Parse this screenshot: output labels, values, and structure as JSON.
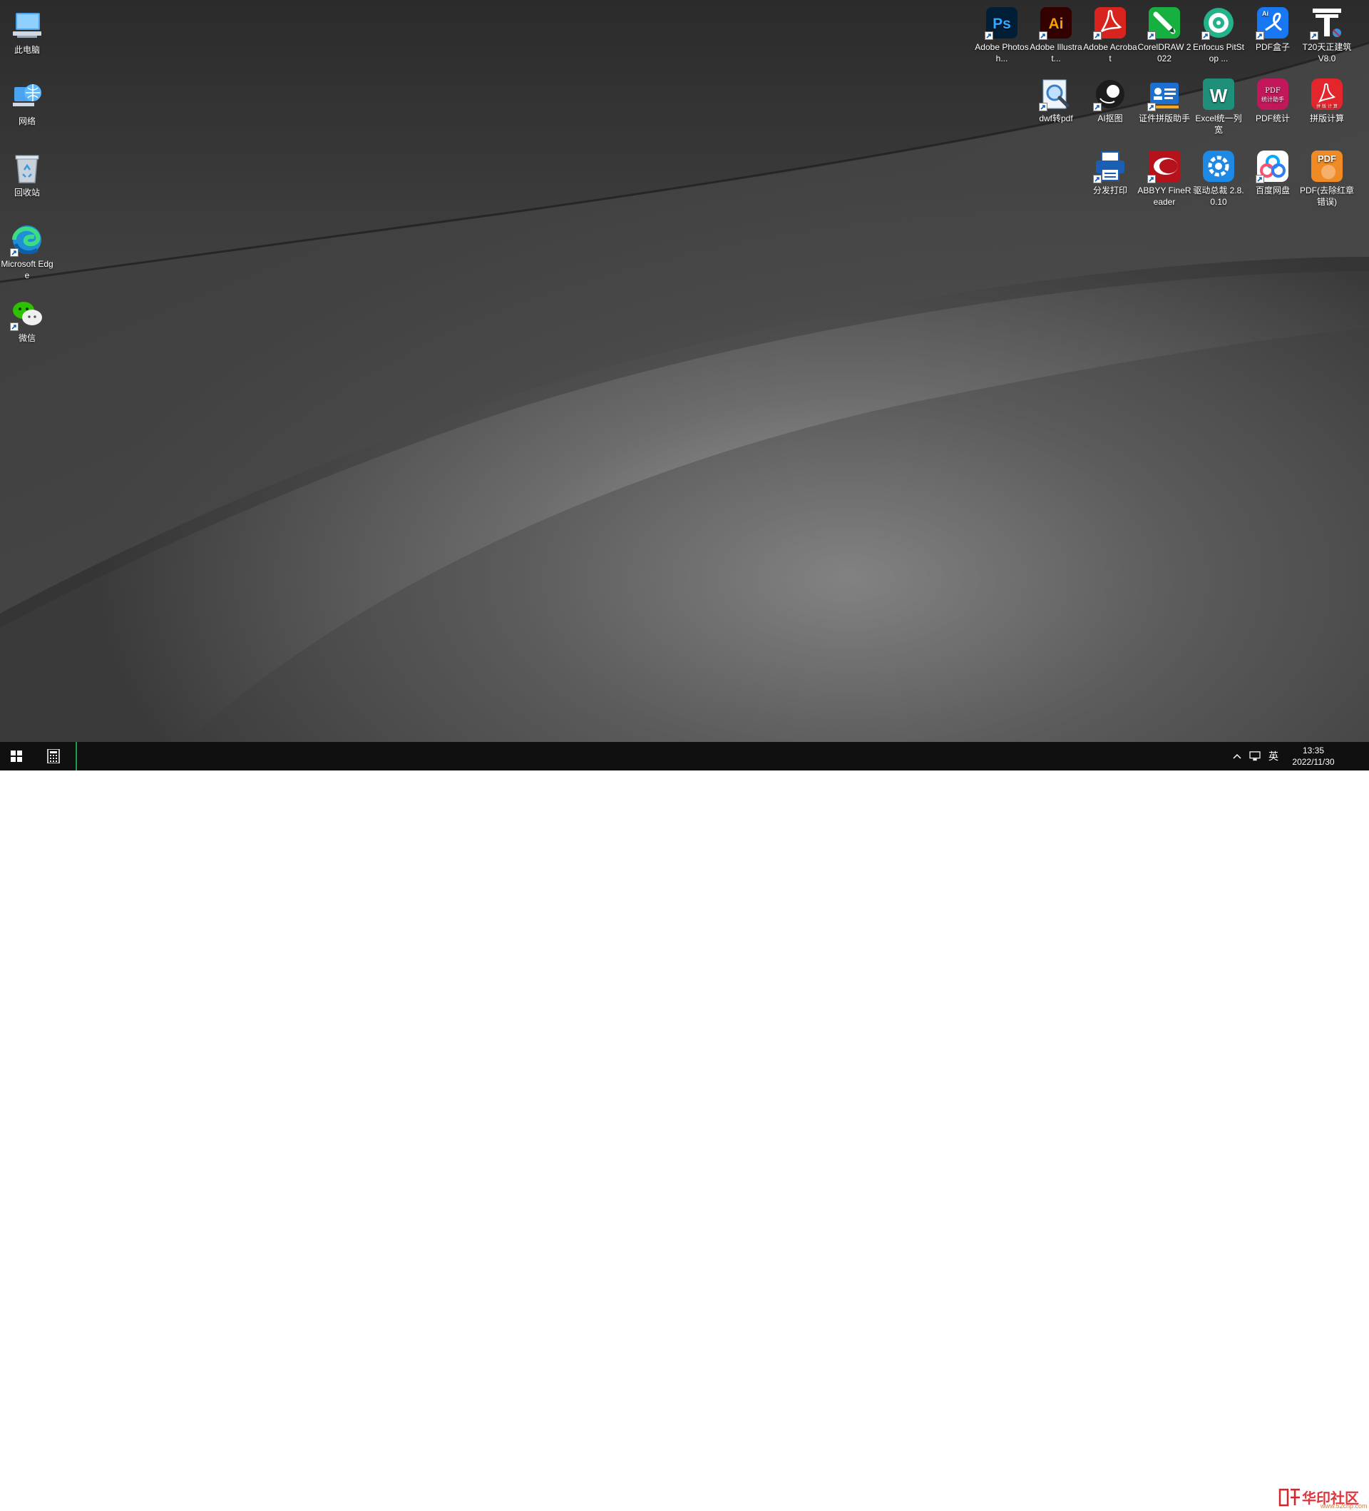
{
  "desktop": {
    "left_icons": [
      {
        "label": "此电脑",
        "icon": "computer-icon"
      },
      {
        "label": "网络",
        "icon": "network-icon"
      },
      {
        "label": "回收站",
        "icon": "recycle-bin-icon"
      },
      {
        "label": "Microsoft Edge",
        "icon": "edge-icon"
      },
      {
        "label": "微信",
        "icon": "wechat-icon"
      }
    ],
    "right_icons_row1": [
      {
        "label": "Adobe Photosh...",
        "icon": "photoshop-icon",
        "glyph": "Ps"
      },
      {
        "label": "Adobe Illustrat...",
        "icon": "illustrator-icon",
        "glyph": "Ai"
      },
      {
        "label": "Adobe Acrobat",
        "icon": "acrobat-icon"
      },
      {
        "label": "CorelDRAW 2022",
        "icon": "coreldraw-icon"
      },
      {
        "label": "Enfocus PitStop ...",
        "icon": "pitstop-icon"
      },
      {
        "label": "PDF盒子",
        "icon": "pdf-box-icon",
        "glyph": "Ai"
      },
      {
        "label": "T20天正建筑 V8.0",
        "icon": "t20-icon"
      }
    ],
    "right_icons_row2": [
      {
        "label": "dwf转pdf",
        "icon": "dwf-to-pdf-icon"
      },
      {
        "label": "AI抠图",
        "icon": "ai-cutout-icon"
      },
      {
        "label": "证件拼版助手",
        "icon": "id-layout-icon"
      },
      {
        "label": "Excel统一列宽",
        "icon": "excel-column-icon",
        "glyph": "W"
      },
      {
        "label": "PDF统计",
        "icon": "pdf-stats-icon",
        "glyph": "PDF",
        "glyph2": "统计助手"
      },
      {
        "label": "拼版计算",
        "icon": "layout-calc-icon",
        "glyph": "拼 版 计 算"
      }
    ],
    "right_icons_row3": [
      {
        "label": "分发打印",
        "icon": "dispatch-print-icon"
      },
      {
        "label": "ABBYY FineReader",
        "icon": "abbyy-icon"
      },
      {
        "label": "驱动总裁 2.8.0.10",
        "icon": "driver-icon"
      },
      {
        "label": "百度网盘",
        "icon": "baidu-netdisk-icon"
      },
      {
        "label": "PDF(去除红章错误)",
        "icon": "pdf-stamp-icon",
        "glyph": "PDF"
      }
    ]
  },
  "taskbar": {
    "ime_label": "英",
    "clock_time": "13:35",
    "clock_date": "2022/11/30"
  },
  "watermark": {
    "text": "华印社区",
    "url": "www.52cnp.com"
  },
  "colors": {
    "taskbar_bg": "#101010",
    "active_indicator": "#1e9e4a",
    "watermark_red": "#d8232a"
  }
}
